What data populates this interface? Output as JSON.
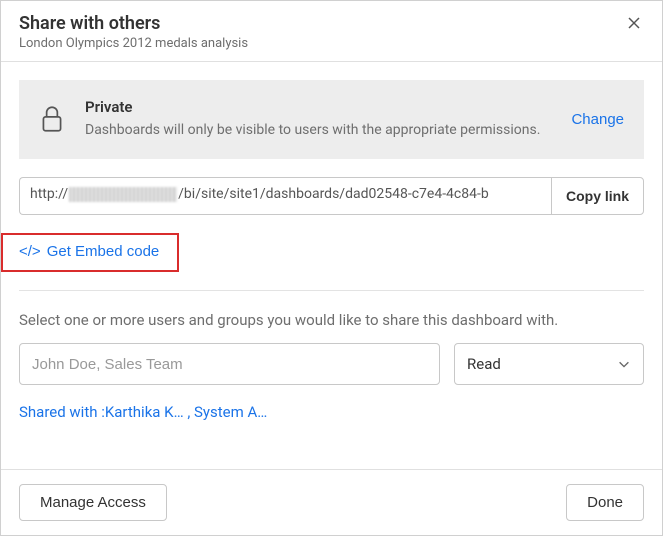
{
  "header": {
    "title": "Share with others",
    "subtitle": "London Olympics 2012 medals analysis"
  },
  "privacy": {
    "title": "Private",
    "desc": "Dashboards will only be visible to users with the appropriate permissions.",
    "change": "Change"
  },
  "link": {
    "prefix": "http://",
    "suffix": "/bi/site/site1/dashboards/dad02548-c7e4-4c84-b",
    "copy": "Copy link"
  },
  "embed": {
    "label": "Get Embed code"
  },
  "instruction": "Select one or more users and groups you would like to share this dashboard with.",
  "share": {
    "placeholder": "John Doe, Sales Team",
    "permission": "Read"
  },
  "shared_with": {
    "label": "Shared with :",
    "names": "Karthika K… , System A…"
  },
  "footer": {
    "manage": "Manage Access",
    "done": "Done"
  }
}
